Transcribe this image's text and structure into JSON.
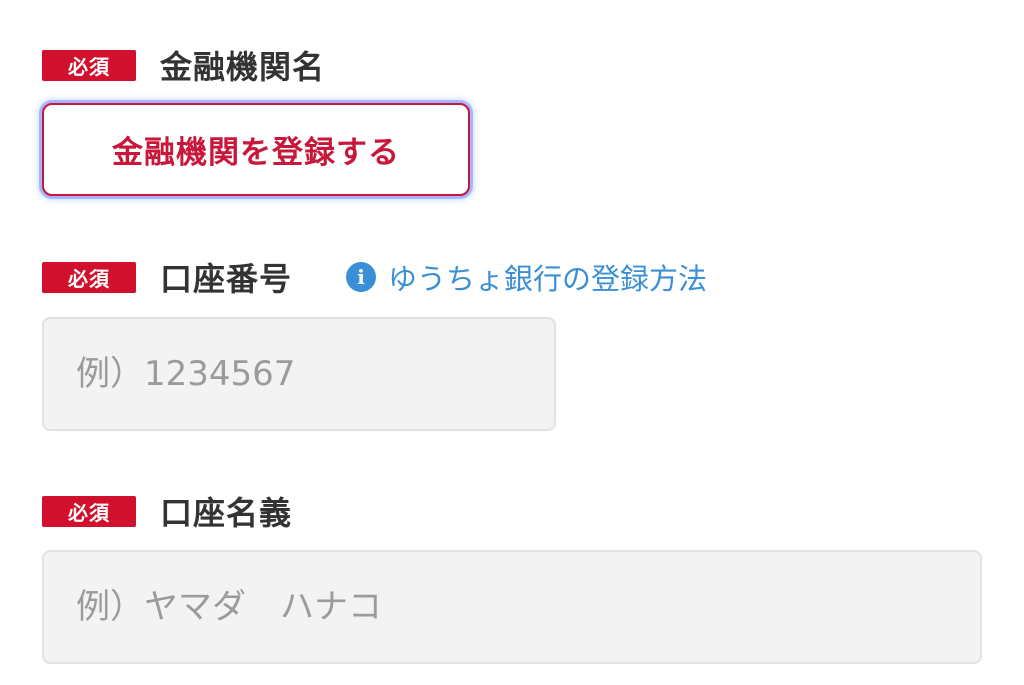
{
  "fields": {
    "bank": {
      "required_label": "必須",
      "label": "金融機関名",
      "button_label": "金融機関を登録する"
    },
    "account_number": {
      "required_label": "必須",
      "label": "口座番号",
      "help_link": "ゆうちょ銀行の登録方法",
      "help_icon_glyph": "i",
      "placeholder": "例）1234567",
      "value": ""
    },
    "account_holder": {
      "required_label": "必須",
      "label": "口座名義",
      "placeholder": "例）ヤマダ　ハナコ",
      "value": ""
    }
  },
  "colors": {
    "required_badge": "#d0102c",
    "accent": "#c8173a",
    "link": "#3b8fd6",
    "input_bg": "#f3f3f3",
    "placeholder": "#9b9b9b"
  },
  "icons": {
    "help_icon": "info-icon"
  }
}
